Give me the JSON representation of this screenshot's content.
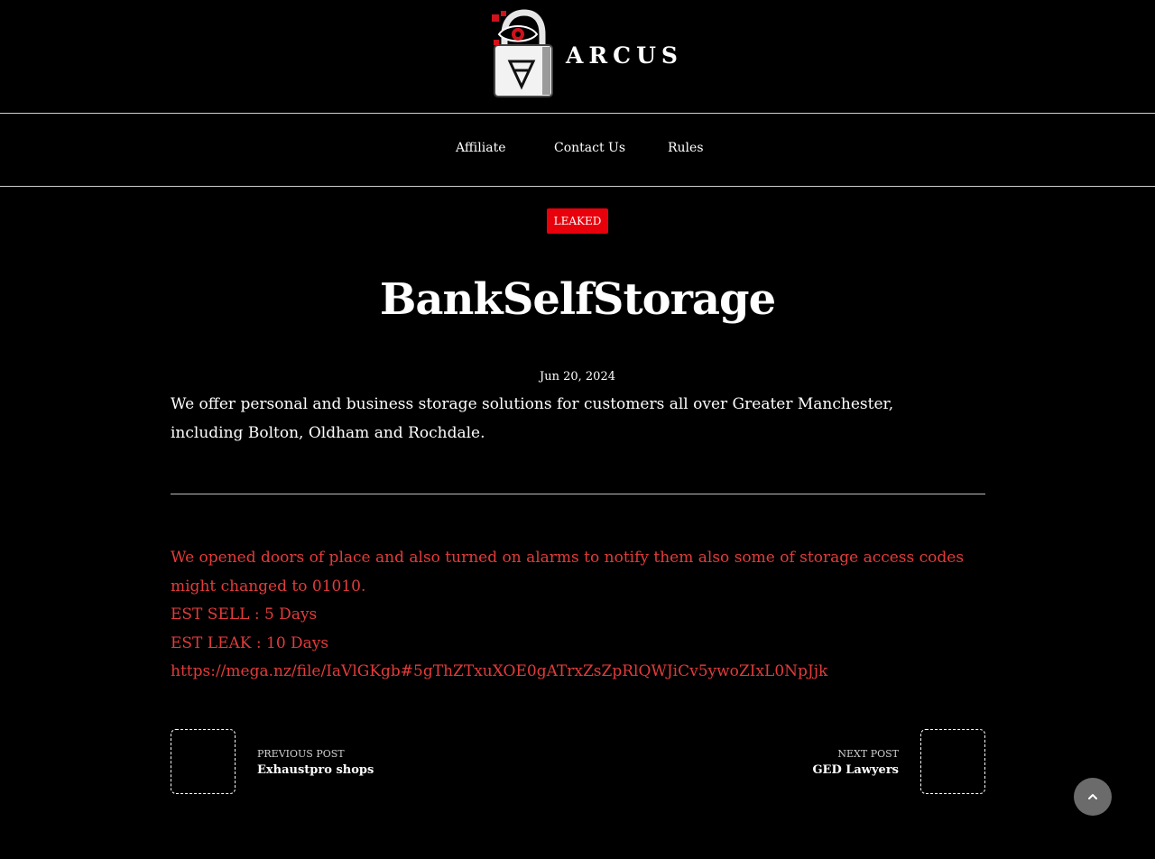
{
  "site": {
    "name": "ARCUS",
    "logo_icon": "padlock-eye-logo"
  },
  "nav": {
    "items": [
      {
        "label": "Affiliate"
      },
      {
        "label": "Contact Us"
      },
      {
        "label": "Rules"
      }
    ]
  },
  "post": {
    "category": "LEAKED",
    "title": "BankSelfStorage",
    "date": "Jun 20, 2024",
    "intro": "We offer personal and business storage solutions for customers all over Greater Manchester, including Bolton, Oldham and Rochdale.",
    "notice": "We opened doors of place and also turned on alarms to notify them also some of storage access codes might changed to 01010.",
    "est_sell": "EST SELL : 5 Days",
    "est_leak": "EST LEAK : 10 Days",
    "link": "https://mega.nz/file/IaVlGKgb#5gThZTxuXOE0gATrxZsZpRlQWJiCv5ywoZIxL0NpJjk"
  },
  "post_nav": {
    "previous": {
      "label": "PREVIOUS POST",
      "title": "Exhaustpro shops"
    },
    "next": {
      "label": "NEXT POST",
      "title": "GED Lawyers"
    }
  },
  "colors": {
    "accent": "#e8000b",
    "text_red": "#e33b3b",
    "background": "#000000"
  },
  "icons": {
    "scroll_top": "chevron-up-icon"
  }
}
